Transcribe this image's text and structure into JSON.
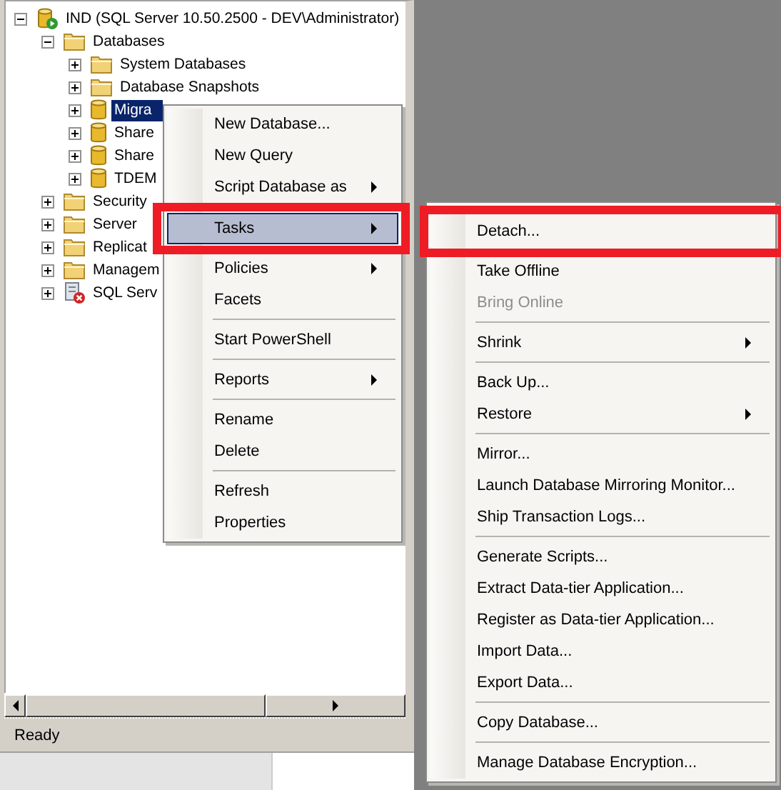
{
  "tree": [
    {
      "label": "IND (SQL Server 10.50.2500 - DEV\\Administrator)",
      "kind": "server",
      "expanded": true,
      "selected": false,
      "children": [
        {
          "label": "Databases",
          "kind": "folder",
          "expanded": true,
          "selected": false,
          "children": [
            {
              "label": "System Databases",
              "kind": "folder",
              "expanded": false,
              "selected": false
            },
            {
              "label": "Database Snapshots",
              "kind": "folder",
              "expanded": false,
              "selected": false
            },
            {
              "label": "Migra",
              "kind": "database",
              "expanded": false,
              "selected": true
            },
            {
              "label": "Share",
              "kind": "database",
              "expanded": false,
              "selected": false
            },
            {
              "label": "Share",
              "kind": "database",
              "expanded": false,
              "selected": false
            },
            {
              "label": "TDEM",
              "kind": "database",
              "expanded": false,
              "selected": false
            }
          ]
        },
        {
          "label": "Security",
          "kind": "folder",
          "expanded": false,
          "selected": false
        },
        {
          "label": "Server",
          "kind": "folder",
          "expanded": false,
          "selected": false
        },
        {
          "label": "Replicat",
          "kind": "folder",
          "expanded": false,
          "selected": false
        },
        {
          "label": "Managem",
          "kind": "folder",
          "expanded": false,
          "selected": false
        },
        {
          "label": "SQL Serv",
          "kind": "agent",
          "expanded": false,
          "selected": false
        }
      ]
    }
  ],
  "status_bar": "Ready",
  "context_menu": [
    {
      "kind": "item",
      "label": "New Database...",
      "submenu": false,
      "selected": false,
      "disabled": false,
      "highlighted": false
    },
    {
      "kind": "item",
      "label": "New Query",
      "submenu": false,
      "selected": false,
      "disabled": false,
      "highlighted": false
    },
    {
      "kind": "item",
      "label": "Script Database as",
      "submenu": true,
      "selected": false,
      "disabled": false,
      "highlighted": false
    },
    {
      "kind": "item",
      "label": "Tasks",
      "submenu": true,
      "selected": true,
      "disabled": false,
      "highlighted": true
    },
    {
      "kind": "item",
      "label": "Policies",
      "submenu": true,
      "selected": false,
      "disabled": false,
      "highlighted": false
    },
    {
      "kind": "item",
      "label": "Facets",
      "submenu": false,
      "selected": false,
      "disabled": false,
      "highlighted": false
    },
    {
      "kind": "separator"
    },
    {
      "kind": "item",
      "label": "Start PowerShell",
      "submenu": false,
      "selected": false,
      "disabled": false,
      "highlighted": false
    },
    {
      "kind": "separator"
    },
    {
      "kind": "item",
      "label": "Reports",
      "submenu": true,
      "selected": false,
      "disabled": false,
      "highlighted": false
    },
    {
      "kind": "separator"
    },
    {
      "kind": "item",
      "label": "Rename",
      "submenu": false,
      "selected": false,
      "disabled": false,
      "highlighted": false
    },
    {
      "kind": "item",
      "label": "Delete",
      "submenu": false,
      "selected": false,
      "disabled": false,
      "highlighted": false
    },
    {
      "kind": "separator"
    },
    {
      "kind": "item",
      "label": "Refresh",
      "submenu": false,
      "selected": false,
      "disabled": false,
      "highlighted": false
    },
    {
      "kind": "item",
      "label": "Properties",
      "submenu": false,
      "selected": false,
      "disabled": false,
      "highlighted": false
    }
  ],
  "tasks_submenu": [
    {
      "kind": "item",
      "label": "Detach...",
      "submenu": false,
      "selected": false,
      "disabled": false,
      "highlighted": true
    },
    {
      "kind": "item",
      "label": "Take Offline",
      "submenu": false,
      "selected": false,
      "disabled": false,
      "highlighted": false
    },
    {
      "kind": "item",
      "label": "Bring Online",
      "submenu": false,
      "selected": false,
      "disabled": true,
      "highlighted": false
    },
    {
      "kind": "separator"
    },
    {
      "kind": "item",
      "label": "Shrink",
      "submenu": true,
      "selected": false,
      "disabled": false,
      "highlighted": false
    },
    {
      "kind": "separator"
    },
    {
      "kind": "item",
      "label": "Back Up...",
      "submenu": false,
      "selected": false,
      "disabled": false,
      "highlighted": false
    },
    {
      "kind": "item",
      "label": "Restore",
      "submenu": true,
      "selected": false,
      "disabled": false,
      "highlighted": false
    },
    {
      "kind": "separator"
    },
    {
      "kind": "item",
      "label": "Mirror...",
      "submenu": false,
      "selected": false,
      "disabled": false,
      "highlighted": false
    },
    {
      "kind": "item",
      "label": "Launch Database Mirroring Monitor...",
      "submenu": false,
      "selected": false,
      "disabled": false,
      "highlighted": false
    },
    {
      "kind": "item",
      "label": "Ship Transaction Logs...",
      "submenu": false,
      "selected": false,
      "disabled": false,
      "highlighted": false
    },
    {
      "kind": "separator"
    },
    {
      "kind": "item",
      "label": "Generate Scripts...",
      "submenu": false,
      "selected": false,
      "disabled": false,
      "highlighted": false
    },
    {
      "kind": "item",
      "label": "Extract Data-tier Application...",
      "submenu": false,
      "selected": false,
      "disabled": false,
      "highlighted": false
    },
    {
      "kind": "item",
      "label": "Register as Data-tier Application...",
      "submenu": false,
      "selected": false,
      "disabled": false,
      "highlighted": false
    },
    {
      "kind": "item",
      "label": "Import Data...",
      "submenu": false,
      "selected": false,
      "disabled": false,
      "highlighted": false
    },
    {
      "kind": "item",
      "label": "Export Data...",
      "submenu": false,
      "selected": false,
      "disabled": false,
      "highlighted": false
    },
    {
      "kind": "separator"
    },
    {
      "kind": "item",
      "label": "Copy Database...",
      "submenu": false,
      "selected": false,
      "disabled": false,
      "highlighted": false
    },
    {
      "kind": "separator"
    },
    {
      "kind": "item",
      "label": "Manage Database Encryption...",
      "submenu": false,
      "selected": false,
      "disabled": false,
      "highlighted": false
    }
  ]
}
